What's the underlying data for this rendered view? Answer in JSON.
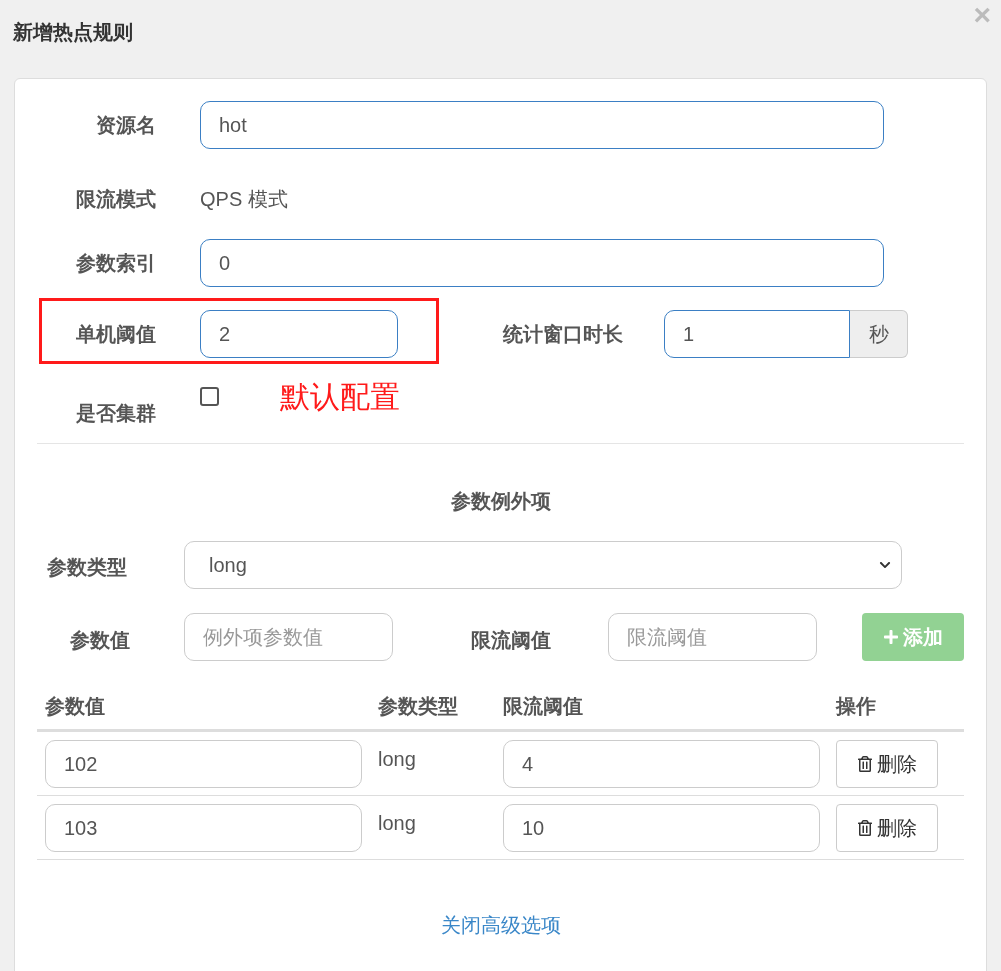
{
  "dialog": {
    "title": "新增热点规则",
    "close": "×"
  },
  "form": {
    "resource": {
      "label": "资源名",
      "value": "hot"
    },
    "mode": {
      "label": "限流模式",
      "value": "QPS 模式"
    },
    "param_index": {
      "label": "参数索引",
      "value": "0"
    },
    "threshold": {
      "label": "单机阈值",
      "value": "2",
      "highlighted": true
    },
    "window": {
      "label": "统计窗口时长",
      "value": "1",
      "unit": "秒"
    },
    "cluster": {
      "label": "是否集群",
      "checked": false
    }
  },
  "annotation": "默认配置",
  "exceptions": {
    "title": "参数例外项",
    "param_type": {
      "label": "参数类型",
      "value": "long"
    },
    "param_value": {
      "label": "参数值",
      "placeholder": "例外项参数值"
    },
    "limit": {
      "label": "限流阈值",
      "placeholder": "限流阈值"
    },
    "add_button": {
      "label": "添加",
      "disabled": true
    },
    "table": {
      "columns": [
        "参数值",
        "参数类型",
        "限流阈值",
        "操作"
      ],
      "rows": [
        {
          "value": "102",
          "type": "long",
          "limit": "4",
          "action": "删除"
        },
        {
          "value": "103",
          "type": "long",
          "limit": "10",
          "action": "删除"
        }
      ]
    }
  },
  "toggle_link": "关闭高级选项"
}
